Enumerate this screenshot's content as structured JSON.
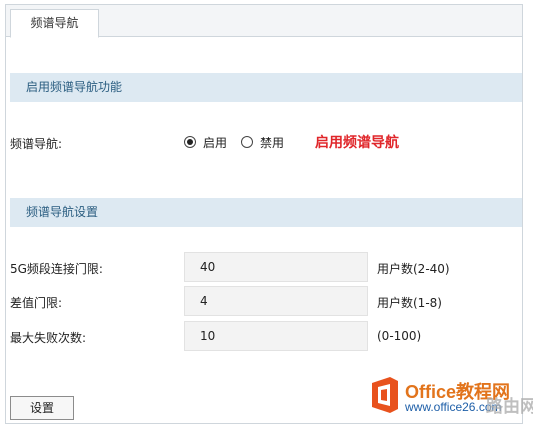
{
  "tabs": [
    {
      "label": "频谱导航"
    }
  ],
  "section_enable": {
    "title": "启用频谱导航功能"
  },
  "spectrum_nav": {
    "label": "频谱导航:",
    "options": [
      {
        "label": "启用",
        "checked": true
      },
      {
        "label": "禁用",
        "checked": false
      }
    ],
    "annotation": "启用频谱导航"
  },
  "section_settings": {
    "title": "频谱导航设置"
  },
  "fields": {
    "threshold_5g": {
      "label": "5G频段连接门限:",
      "value": "40",
      "unit": "用户数(2-40)"
    },
    "difference": {
      "label": "差值门限:",
      "value": "4",
      "unit": "用户数(1-8)"
    },
    "max_failures": {
      "label": "最大失败次数:",
      "value": "10",
      "unit": "(0-100)"
    }
  },
  "actions": {
    "apply_label": "设置"
  },
  "watermark": {
    "brand": "Office教程网",
    "url": "www.office26.com",
    "side_text": "路由网"
  },
  "colors": {
    "section_bg": "#dde9f2",
    "section_text": "#2a5d80",
    "annotation_red": "#e0262a",
    "brand_orange": "#e2741c"
  }
}
